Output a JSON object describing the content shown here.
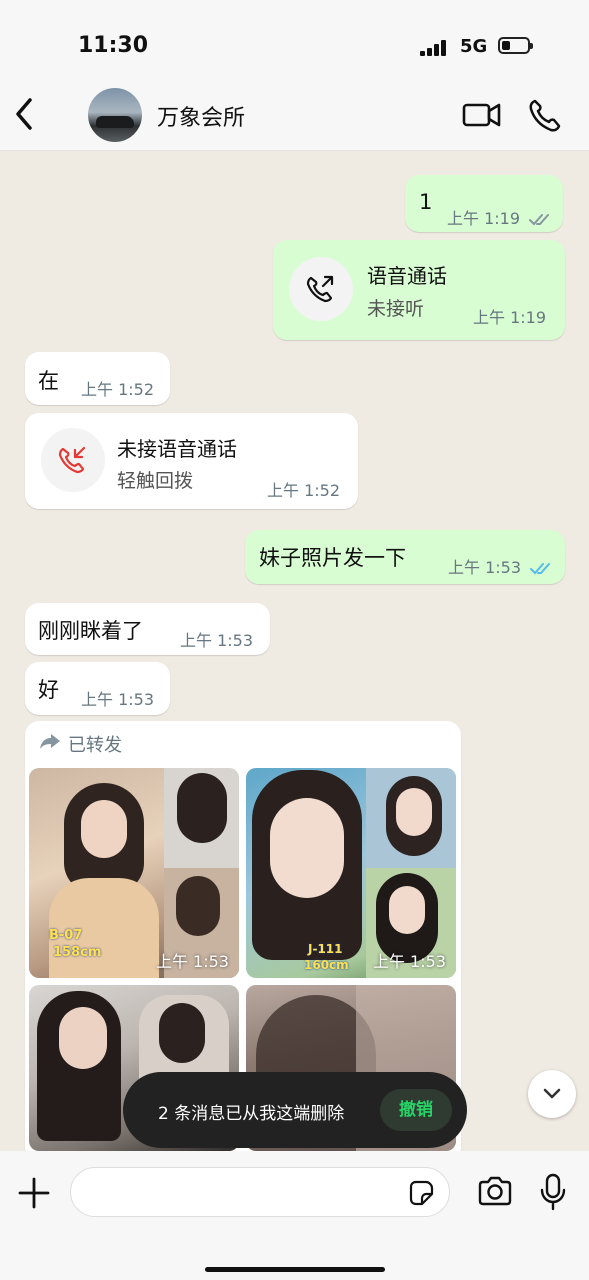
{
  "status_bar": {
    "time": "11:30",
    "network": "5G",
    "battery_level": 0.35
  },
  "header": {
    "contact_name": "万象会所"
  },
  "messages": {
    "m1": {
      "text": "1",
      "time": "上午 1:19"
    },
    "m2": {
      "title": "语音通话",
      "subtitle": "未接听",
      "time": "上午 1:19"
    },
    "m3": {
      "text": "在",
      "time": "上午 1:52"
    },
    "m4": {
      "title": "未接语音通话",
      "subtitle": "轻触回拨",
      "time": "上午 1:52"
    },
    "m5": {
      "text": "妹子照片发一下",
      "time": "上午 1:53"
    },
    "m6": {
      "text": "刚刚眯着了",
      "time": "上午 1:53"
    },
    "m7": {
      "text": "好",
      "time": "上午 1:53"
    },
    "m8": {
      "forwarded_label": "已转发",
      "images": [
        {
          "time": "上午 1:53",
          "caption": [
            "B-07",
            "158cm"
          ]
        },
        {
          "time": "上午 1:53",
          "caption": [
            "J-111",
            "160cm"
          ]
        },
        {
          "time": ""
        },
        {
          "time": ""
        }
      ]
    }
  },
  "toast": {
    "text": "2 条消息已从我这端删除",
    "undo_label": "撤销"
  },
  "input": {
    "placeholder": "",
    "value": ""
  },
  "icons": {
    "back": "chevron-left-icon",
    "video": "video-camera-icon",
    "phone": "phone-icon",
    "attach": "plus-icon",
    "sticker": "sticker-icon",
    "camera": "camera-icon",
    "mic": "microphone-icon",
    "scroll": "chevron-down-icon",
    "forward": "forward-arrow-icon"
  },
  "colors": {
    "outgoing_bubble": "#d9fdd3",
    "incoming_bubble": "#ffffff",
    "read_ticks": "#53bdeb",
    "missed_call": "#e53935",
    "accent": "#25d366"
  }
}
